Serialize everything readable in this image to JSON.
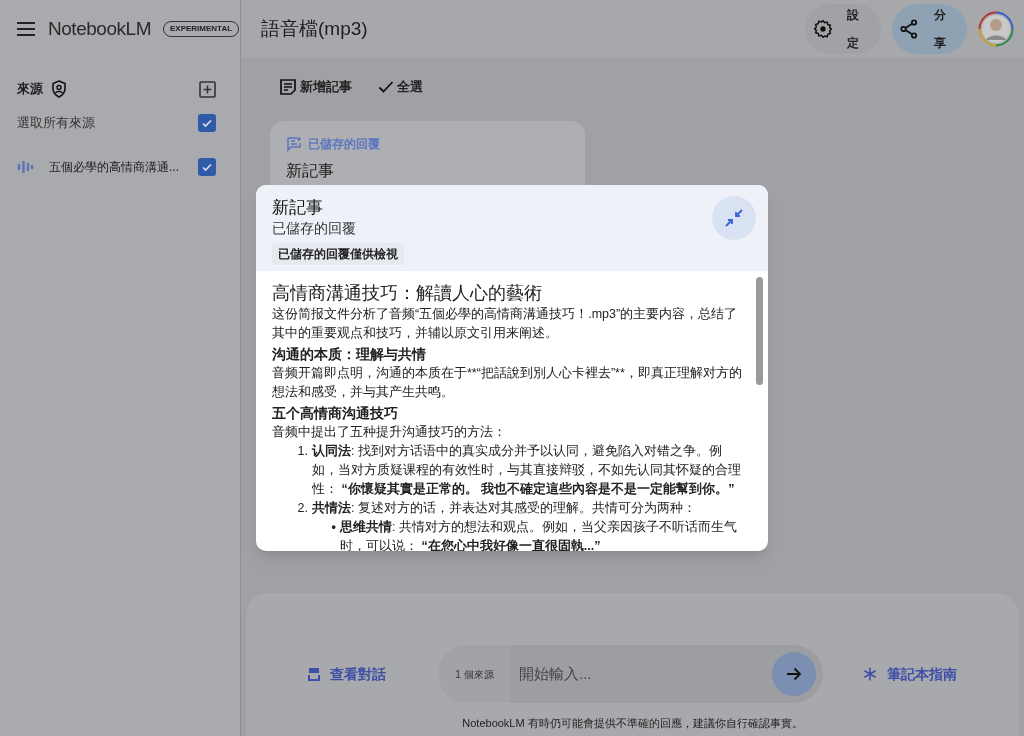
{
  "sidebar": {
    "brand": "NotebookLM",
    "badge": "EXPERIMENTAL",
    "sources_title": "來源",
    "select_all": {
      "label": "選取所有來源",
      "checked": true
    },
    "sources": [
      {
        "title": "五個必學的高情商溝通...",
        "checked": true
      }
    ]
  },
  "header": {
    "title": "語音檔(mp3)",
    "settings": "設定",
    "share": "分享"
  },
  "toolbar": [
    "新增記事",
    "全選"
  ],
  "note_card": {
    "tag": "已儲存的回覆",
    "title": "新記事"
  },
  "modal": {
    "title": "新記事",
    "subtitle": "已儲存的回覆",
    "chip": "已儲存的回覆僅供檢視",
    "blocks": [
      {
        "kind": "title",
        "text": "高情商溝通技巧：解讀人心的藝術"
      },
      {
        "kind": "paragraph",
        "text": "这份简报文件分析了音频“五個必學的高情商溝通技巧！.mp3”的主要内容，总结了其中的重要观点和技巧，并辅以原文引用来阐述。"
      },
      {
        "kind": "heading",
        "text": "沟通的本质：理解与共情"
      },
      {
        "kind": "paragraph",
        "text": "音频开篇即点明，沟通的本质在于**“把話說到別人心卡裡去”**，即真正理解对方的想法和感受，并与其产生共鸣。"
      },
      {
        "kind": "heading",
        "text": "五个高情商沟通技巧"
      },
      {
        "kind": "paragraph",
        "text": "音频中提出了五种提升沟通技巧的方法："
      },
      {
        "kind": "list",
        "items": [
          {
            "marker": "1.",
            "text": "**认同法**: 找到对方话语中的真实成分并予以认同，避免陷入对错之争。例如，当对方质疑课程的有效性时，与其直接辩驳，不如先认同其怀疑的合理性： **“你懷疑其實是正常的。 我也不確定這些內容是不是一定能幫到你。”**"
          },
          {
            "marker": "2.",
            "text": "**共情法**: 复述对方的话，并表达对其感受的理解。共情可分为两种：",
            "children": [
              {
                "marker": "•",
                "text": "**思维共情**: 共情对方的想法和观点。例如，当父亲因孩子不听话而生气时，可以说： **“在您心中我好像一直很固執...”**"
              }
            ]
          }
        ]
      }
    ]
  },
  "composer": {
    "view_chat": "查看對話",
    "source_count": "1 個來源",
    "placeholder": "開始輸入...",
    "guide": "筆記本指南"
  },
  "disclaimer": "NotebookLM 有時仍可能會提供不準確的回應，建議你自行確認事實。"
}
